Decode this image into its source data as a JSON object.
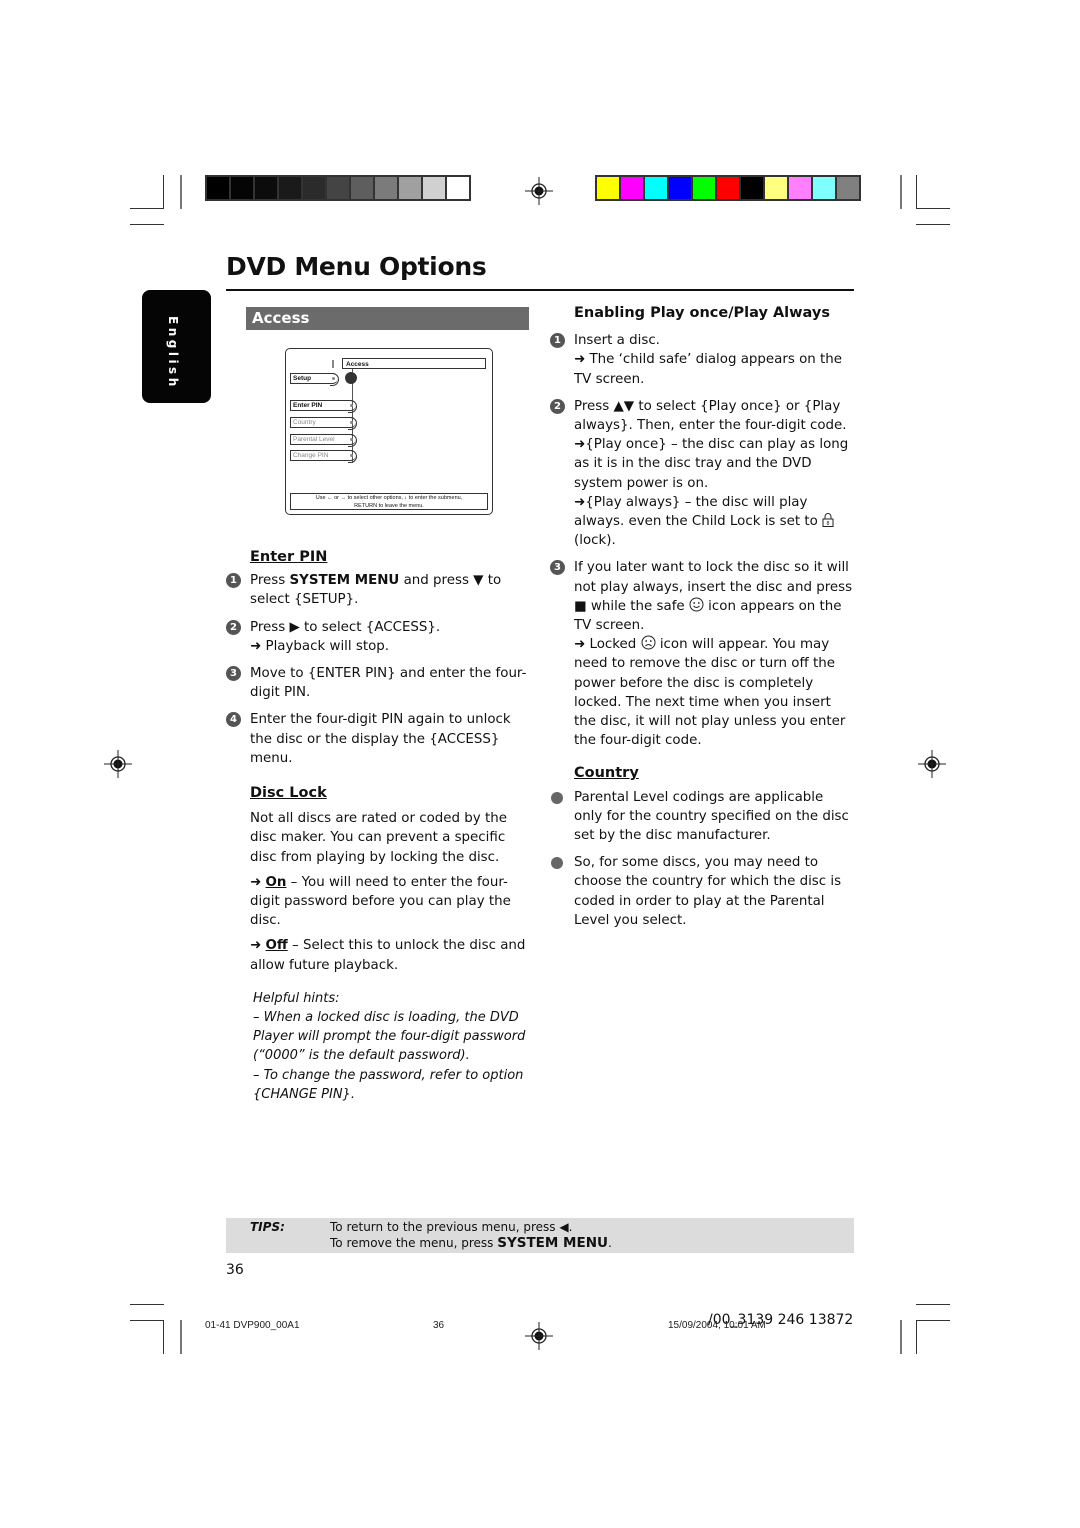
{
  "page": {
    "title": "DVD Menu Options",
    "language_tab": "English",
    "section_header": "Access",
    "page_number": "36"
  },
  "print_marks": {
    "grayscale_bar": [
      "#000000",
      "#050505",
      "#0c0c0c",
      "#1a1a1a",
      "#2b2b2b",
      "#444444",
      "#5e5e5e",
      "#7b7b7b",
      "#a0a0a0",
      "#d0d0d0",
      "#ffffff"
    ],
    "color_bar": [
      "#ffff00",
      "#ff00ff",
      "#00ffff",
      "#0000ff",
      "#00ff00",
      "#ff0000",
      "#000000",
      "#ffff80",
      "#ff80ff",
      "#80ffff",
      "#808080"
    ]
  },
  "osd_menu": {
    "header": "Access",
    "root": "Setup",
    "items": [
      {
        "label": "Enter PIN",
        "state": "active"
      },
      {
        "label": "Country",
        "state": "dim"
      },
      {
        "label": "Parental Level",
        "state": "dim"
      },
      {
        "label": "Change PIN",
        "state": "dim"
      }
    ],
    "footer_line1": "Use ← or → to select other options, ↓ to enter the submenu,",
    "footer_line2": "RETURN to leave the menu."
  },
  "enter_pin": {
    "heading": "Enter PIN",
    "steps": [
      {
        "n": "1",
        "pre": "Press ",
        "bold": "SYSTEM MENU",
        "post": " and press ▼ to select {SETUP}."
      },
      {
        "n": "2",
        "text": "Press ▶ to select {ACCESS}.",
        "result": "Playback will stop."
      },
      {
        "n": "3",
        "text": "Move to {ENTER PIN} and enter the four-digit PIN."
      },
      {
        "n": "4",
        "text": "Enter the four-digit PIN again to unlock the disc or the display the {ACCESS} menu."
      }
    ]
  },
  "disc_lock": {
    "heading": "Disc Lock",
    "intro": "Not all discs are rated or coded by the disc maker. You can prevent a specific disc from playing by locking the disc.",
    "on_label": "On",
    "on_text": " – You will need to enter the four-digit password before you can play the disc.",
    "off_label": "Off",
    "off_text": " – Select this to unlock the disc and allow future playback."
  },
  "hints": {
    "title": "Helpful hints:",
    "line1": "– When a locked disc is loading, the DVD Player will prompt the four-digit password (“0000” is the default password).",
    "line2": "– To change the password, refer to option {CHANGE PIN}."
  },
  "play_once": {
    "heading": "Enabling Play once/Play Always",
    "step1": {
      "n": "1",
      "text": "Insert a disc.",
      "result": "The ‘child safe’ dialog appears on the TV screen."
    },
    "step2": {
      "n": "2",
      "text": "Press ▲▼  to select {Play once} or {Play always}. Then, enter the four-digit code.",
      "result1": "{Play once} – the disc can play as long as it is in the disc tray and the DVD system power is on.",
      "result2_pre": "{Play always} – the disc will play always. even the Child Lock is set to ",
      "result2_post": " (lock)."
    },
    "step3": {
      "n": "3",
      "text_pre": "If you later want to lock the disc so it will not play always, insert the disc and press ",
      "stop_glyph": "■",
      "text_mid": "  while the safe ",
      "text_post": " icon appears on the TV screen.",
      "result_pre": "Locked ",
      "result_post": " icon will appear. You may need to remove the disc or turn off the power before the disc is completely locked. The next time when you insert the disc, it will not play unless you enter the four-digit code."
    }
  },
  "country": {
    "heading": "Country",
    "bullets": [
      "Parental Level codings are applicable only for the country specified on the disc set by the disc manufacturer.",
      "So, for some discs, you may need to choose the country for which the disc is coded in order to play at the Parental Level you select."
    ]
  },
  "tips": {
    "label": "TIPS:",
    "line1": "To return to the previous menu, press ◀.",
    "line2_pre": "To remove the menu, press ",
    "line2_bold": "SYSTEM MENU",
    "line2_post": "."
  },
  "footer": {
    "file_id": "01-41 DVP900_00A1",
    "page": "36",
    "datetime": "15/09/2004, 10:01 AM",
    "code": "/00_3139 246 13872"
  },
  "arrow_glyph": "➜"
}
